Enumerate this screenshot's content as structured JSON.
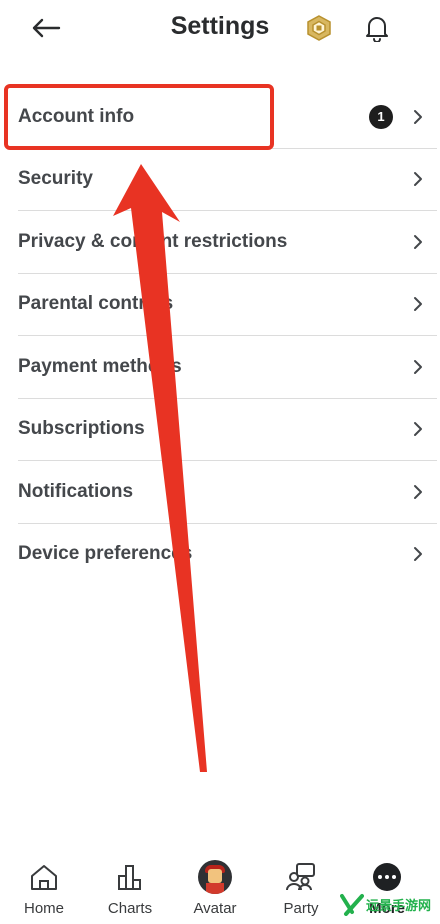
{
  "header": {
    "title": "Settings",
    "back_icon": "arrow-left-icon",
    "robux_icon": "robux-hexagon-icon",
    "bell_icon": "bell-icon"
  },
  "settings": {
    "items": [
      {
        "label": "Account info",
        "badge": "1"
      },
      {
        "label": "Security"
      },
      {
        "label": "Privacy & content restrictions"
      },
      {
        "label": "Parental controls"
      },
      {
        "label": "Payment methods"
      },
      {
        "label": "Subscriptions"
      },
      {
        "label": "Notifications"
      },
      {
        "label": "Device preferences"
      }
    ]
  },
  "tabbar": {
    "tabs": [
      {
        "label": "Home",
        "icon": "home-icon"
      },
      {
        "label": "Charts",
        "icon": "charts-icon"
      },
      {
        "label": "Avatar",
        "icon": "avatar-icon"
      },
      {
        "label": "Party",
        "icon": "party-icon"
      },
      {
        "label": "More",
        "icon": "more-icon"
      }
    ]
  },
  "watermark": {
    "text": "远景手游网"
  },
  "colors": {
    "annotation_red": "#e83323",
    "text": "#44474b",
    "divider": "#dcdcdc",
    "robux_gold": "#c9a44a",
    "watermark_green": "#23b14d"
  }
}
